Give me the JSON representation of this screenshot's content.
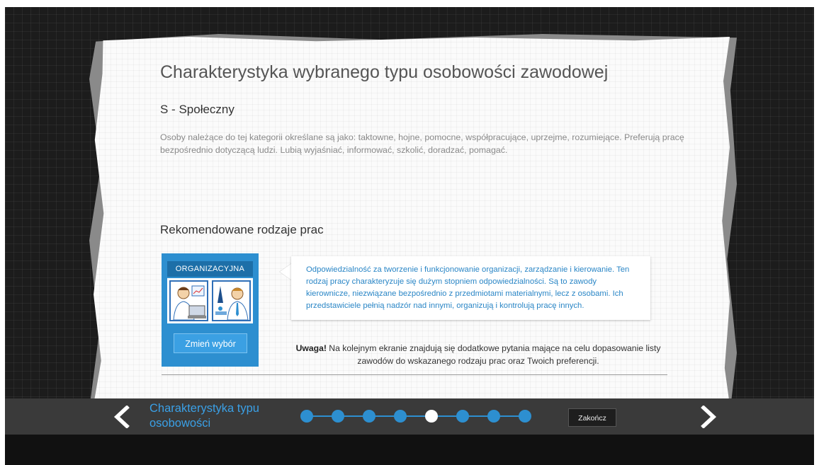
{
  "content": {
    "title": "Charakterystyka wybranego typu osobowości zawodowej",
    "type_name": "S - Społeczny",
    "description": "Osoby należące do tej kategorii określane są jako: taktowne, hojne, pomocne, współpracujące, uprzejme, rozumiejące. Preferują pracę bezpośrednio dotyczącą ludzi. Lubią wyjaśniać, informować, szkolić, doradzać, pomagać.",
    "recommended_heading": "Rekomendowane rodzaje prac"
  },
  "card": {
    "title": "ORGANIZACYJNA",
    "change_button": "Zmień wybór"
  },
  "bubble": {
    "text": "Odpowiedzialność za tworzenie i funkcjonowanie organizacji, zarządzanie i kierowanie. Ten rodzaj pracy charakteryzuje się dużym stopniem odpowiedzialności. Są to zawody kierownicze, niezwiązane bezpośrednio z przedmiotami materialnymi, lecz z osobami. Ich przedstawiciele pełnią nadzór nad innymi, organizują i kontrolują pracę innych."
  },
  "note": {
    "label": "Uwaga!",
    "text": " Na kolejnym ekranie znajdują się dodatkowe pytania mające na celu dopasowanie listy zawodów do wskazanego rodzaju prac oraz Twoich preferencji."
  },
  "nav": {
    "step_label": "Charakterystyka typu osobowości",
    "steps_total": 8,
    "active_step": 5,
    "end_button": "Zakończ",
    "prev_icon": "chevron-left-icon",
    "next_icon": "chevron-right-icon"
  },
  "colors": {
    "accent": "#2d8fd0",
    "bubble_text": "#2a86c6",
    "nav_bar": "#3a3a3a",
    "background": "#1c1c1c"
  }
}
